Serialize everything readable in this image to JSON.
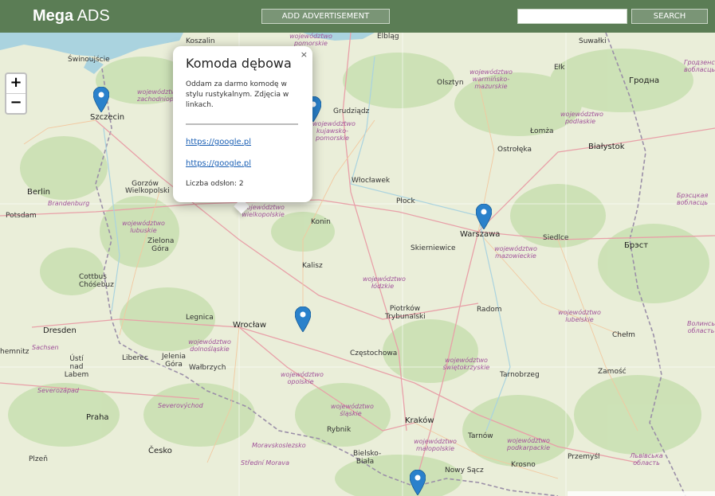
{
  "header": {
    "brand_bold": "Mega",
    "brand_light": "ADS",
    "add_button": "ADD ADVERTISEMENT",
    "search_value": "",
    "search_button": "SEARCH"
  },
  "map": {
    "zoom_in": "+",
    "zoom_out": "−",
    "cities": {
      "koszalin": "Koszalin",
      "elblag": "Elbląg",
      "suwalki": "Suwałki",
      "swinoujscie": "Świnoujście",
      "szczecin": "Szczecin",
      "olsztyn": "Olsztyn",
      "elk": "Ełk",
      "grodno": "Гродна",
      "grudziadz": "Grudziądz",
      "lomza": "Łomża",
      "ostroleka": "Ostrołęka",
      "bialystok": "Białystok",
      "gorzow": "Gorzów Wielkopolski",
      "berlin": "Berlin",
      "wloclawek": "Włocławek",
      "plock": "Płock",
      "potsdam": "Potsdam",
      "brandenburg": "Brandenburg",
      "konin": "Konin",
      "warszawa": "Warszawa",
      "siedlce": "Siedlce",
      "zielona_gora": "Zielona Góra",
      "skierniewice": "Skierniewice",
      "brest": "Брэст",
      "cottbus": "Cottbus Chóśebuz",
      "kalisz": "Kalisz",
      "piotrkow": "Piotrków Trybunalski",
      "radom": "Radom",
      "dresden": "Dresden",
      "legnica": "Legnica",
      "wroclaw": "Wrocław",
      "chelm": "Chełm",
      "chemnitz": "hemnitz",
      "sachsen": "Sachsen",
      "liberec": "Liberec",
      "jelenia_gora": "Jelenia Góra",
      "walbrzych": "Wałbrzych",
      "czestochowa": "Częstochowa",
      "usti": "Ústí nad Labem",
      "tarnobrzeg": "Tarnobrzeg",
      "zamosc": "Zamość",
      "severozapad": "Severozápad",
      "severovychod": "Severovýchod",
      "praha": "Praha",
      "rybnik": "Rybnik",
      "krakow": "Kraków",
      "tarnow": "Tarnów",
      "cesko": "Česko",
      "moravskoslezsko": "Moravskoslezsko",
      "bielsko": "Bielsko-Biała",
      "plzen": "Plzeň",
      "stredni_morava": "Střední Morava",
      "krosno": "Krosno",
      "przemysl": "Przemyśl",
      "nowy_sacz": "Nowy Sącz"
    },
    "regions": {
      "pomorskie": "województwo pomorskie",
      "warminsko": "województwo warmińsko-mazurskie",
      "zachodnio": "województwo zachodniopomorskie",
      "podlaskie": "województwo podlaskie",
      "kujawsko": "województwo kujawsko-pomorskie",
      "lubuskie": "województwo lubuskie",
      "wielkopolskie": "województwo wielkopolskie",
      "mazowieckie": "województwo mazowieckie",
      "lodzkie": "województwo łódzkie",
      "dolnoslaskie": "województwo dolnośląskie",
      "lubelskie": "województwo lubelskie",
      "opolskie": "województwo opolskie",
      "swietokrzyskie": "województwo świętokrzyskie",
      "slaskie": "województwo śląskie",
      "malopolskie": "województwo małopolskie",
      "podkarpackie": "województwo podkarpackie",
      "grodno_oblast": "Гродзенская вобласць",
      "brest_oblast": "Брэсцкая вобласць",
      "volyn": "Волинська область",
      "lviv": "Львівська область"
    }
  },
  "popup": {
    "close": "×",
    "title": "Komoda dębowa",
    "description": "Oddam za darmo komodę w stylu rustykalnym. Zdjęcia w linkach.",
    "link1": "https://google.pl",
    "link2": "https://google.pl",
    "views": "Liczba odsłon: 2"
  },
  "colors": {
    "header_bg": "#5b7d55",
    "button_bg": "#7a9576",
    "marker": "#2a81cb",
    "region_label": "#a0529a",
    "link": "#1a5fb4"
  }
}
